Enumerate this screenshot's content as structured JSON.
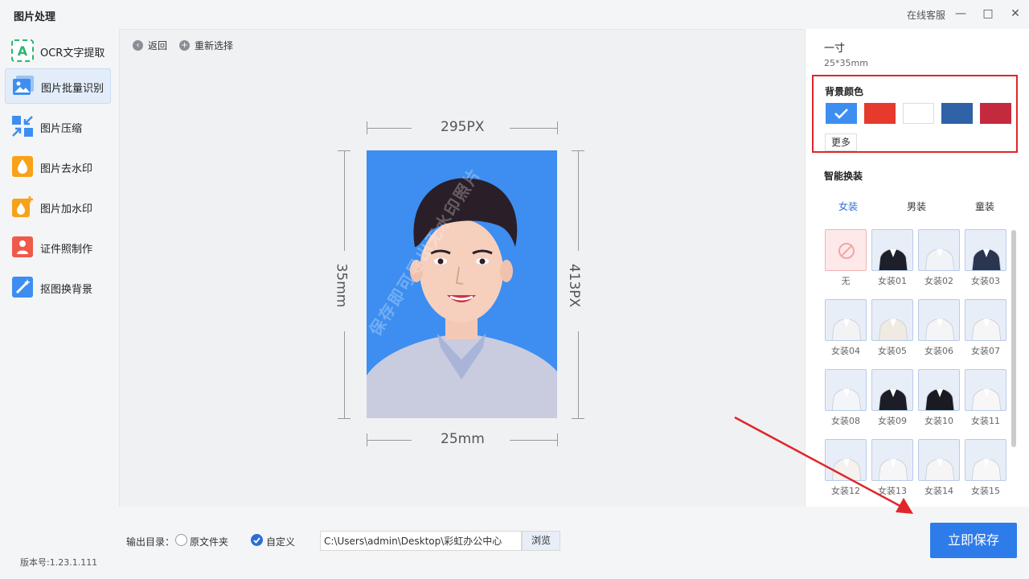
{
  "app": {
    "title": "图片处理",
    "service": "在线客服",
    "version": "版本号:1.23.1.111"
  },
  "sidebar": {
    "items": [
      {
        "label": "OCR文字提取",
        "active": false
      },
      {
        "label": "图片批量识别",
        "active": true
      },
      {
        "label": "图片压缩",
        "active": false
      },
      {
        "label": "图片去水印",
        "active": false
      },
      {
        "label": "图片加水印",
        "active": false
      },
      {
        "label": "证件照制作",
        "active": false
      },
      {
        "label": "抠图换背景",
        "active": false
      }
    ]
  },
  "toolbar": {
    "back": "返回",
    "reselect": "重新选择"
  },
  "preview": {
    "width_px": "295PX",
    "height_px": "413PX",
    "width_mm": "25mm",
    "height_mm": "35mm",
    "watermark": "保存即可导出无水印照片"
  },
  "panel": {
    "spec_name": "一寸",
    "spec_size": "25*35mm",
    "bg_title": "背景颜色",
    "bg_colors": [
      "#3d8ef0",
      "#e63a2c",
      "#ffffff",
      "#2f62a6",
      "#c42a3e"
    ],
    "more": "更多",
    "smart_title": "智能换装",
    "tabs": [
      "女装",
      "男装",
      "童装"
    ],
    "clothes": [
      "无",
      "女装01",
      "女装02",
      "女装03",
      "女装04",
      "女装05",
      "女装06",
      "女装07",
      "女装08",
      "女装09",
      "女装10",
      "女装11",
      "女装12",
      "女装13",
      "女装14",
      "女装15"
    ]
  },
  "bottom": {
    "output_label": "输出目录：",
    "opt_original": "原文件夹",
    "opt_custom": "自定义",
    "path": "C:\\Users\\admin\\Desktop\\彩虹办公中心",
    "browse": "浏览",
    "save": "立即保存"
  },
  "colors": {
    "accent": "#2e7bea",
    "highlight": "#e0262b"
  }
}
